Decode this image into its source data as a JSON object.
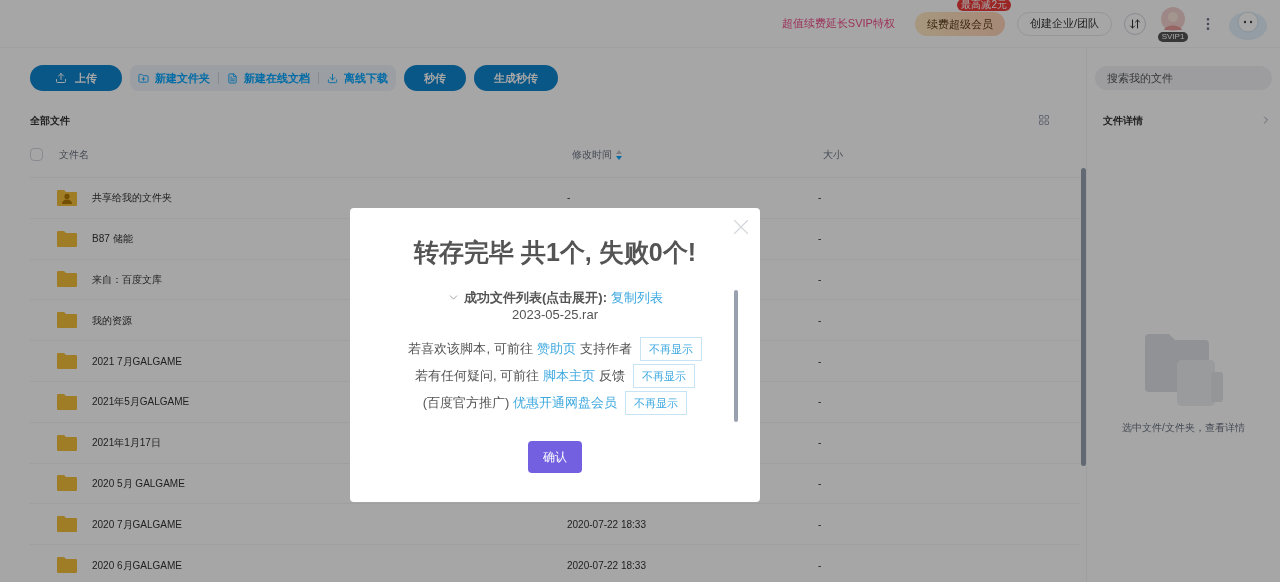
{
  "top_bar": {
    "promo": "超值续费延长SVIP特权",
    "renew_button": "续费超级会员",
    "renew_badge": "最高减2元",
    "enterprise_button": "创建企业/团队",
    "avatar_badge": "SVIP1"
  },
  "toolbar": {
    "upload": "上传",
    "actions": [
      {
        "kind": "folder",
        "label": "新建文件夹"
      },
      {
        "kind": "doc",
        "label": "新建在线文档"
      },
      {
        "kind": "download",
        "label": "离线下载"
      }
    ],
    "extra_buttons": [
      "秒传",
      "生成秒传"
    ]
  },
  "breadcrumb": "全部文件",
  "table": {
    "columns": [
      "文件名",
      "修改时间",
      "大小"
    ],
    "select_all": {
      "checked": false
    },
    "rows": [
      {
        "name": "共享给我的文件夹",
        "shared": true,
        "modified": "-",
        "size": "-"
      },
      {
        "name": "B87 储能",
        "shared": false,
        "size": "-"
      },
      {
        "name": "来自：百度文库",
        "shared": false,
        "size": "-"
      },
      {
        "name": "我的资源",
        "shared": false,
        "size": "-"
      },
      {
        "name": "2021 7月GALGAME",
        "shared": false,
        "size": "-"
      },
      {
        "name": "2021年5月GALGAME",
        "shared": false,
        "size": "-"
      },
      {
        "name": "2021年1月17日",
        "shared": false,
        "size": "-"
      },
      {
        "name": "2020 5月 GALGAME",
        "shared": false,
        "size": "-"
      },
      {
        "name": "2020 7月GALGAME",
        "shared": false,
        "modified": "2020-07-22 18:33",
        "size": "-"
      },
      {
        "name": "2020 6月GALGAME",
        "shared": false,
        "modified": "2020-07-22 18:33",
        "size": "-"
      }
    ]
  },
  "detail_panel": {
    "search_placeholder": "搜索我的文件",
    "title": "文件详情",
    "empty_text": "选中文件/文件夹，查看详情"
  },
  "modal": {
    "title": "转存完毕 共1个, 失败0个!",
    "list_toggle": {
      "label": "成功文件列表(点击展开):",
      "expanded": false
    },
    "copy_link": "复制列表",
    "files": [
      "2023-05-25.rar"
    ],
    "notices": [
      {
        "before": "若喜欢该脚本, 可前往",
        "link": "赞助页",
        "after": "支持作者",
        "dismiss": "不再显示"
      },
      {
        "before": "若有任何疑问, 可前往",
        "link": "脚本主页",
        "after": "反馈",
        "dismiss": "不再显示"
      },
      {
        "before": "(百度官方推广)",
        "link": "优惠开通网盘会员",
        "dismiss": "不再显示"
      }
    ],
    "confirm": "确认"
  }
}
